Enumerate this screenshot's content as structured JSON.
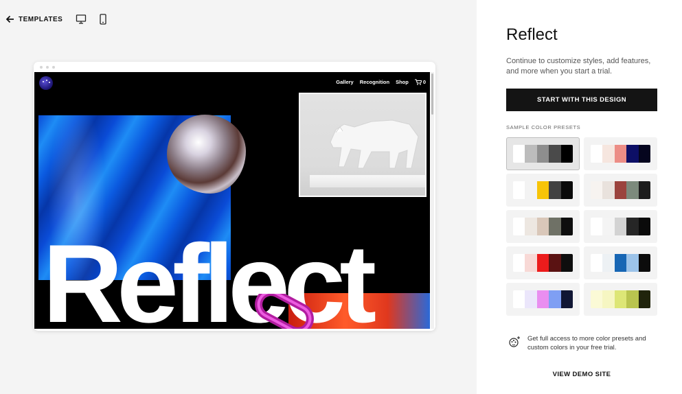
{
  "topbar": {
    "back_label": "TEMPLATES",
    "back_icon": "arrow-left-icon",
    "desktop_icon": "desktop-icon",
    "mobile_icon": "mobile-icon"
  },
  "preview": {
    "nav": [
      "Gallery",
      "Recognition",
      "Shop"
    ],
    "cart_count": "0",
    "hero_word": "Reflect"
  },
  "panel": {
    "title": "Reflect",
    "description": "Continue to customize styles, add features, and more when you start a trial.",
    "start_button": "START WITH THIS DESIGN",
    "presets_label": "SAMPLE COLOR PRESETS",
    "upsell": "Get full access to more color presets and custom colors in your free trial.",
    "demo_link": "VIEW DEMO SITE"
  },
  "presets": [
    [
      "#ffffff",
      "#bcbcbc",
      "#8e8e8e",
      "#4a4a4a",
      "#000000"
    ],
    [
      "#ffffff",
      "#f6e6df",
      "#ec8d86",
      "#0d0f66",
      "#05051e"
    ],
    [
      "#ffffff",
      "#f3f3f3",
      "#f7c408",
      "#424242",
      "#0b0b0b"
    ],
    [
      "#f7f3f0",
      "#e9e2dd",
      "#9b433d",
      "#7c8a7c",
      "#1c1c1c"
    ],
    [
      "#ffffff",
      "#ede7e1",
      "#d9c7b9",
      "#6f7166",
      "#0e0e0e"
    ],
    [
      "#ffffff",
      "#f4f4f4",
      "#d3d3d3",
      "#262626",
      "#0b0b0b"
    ],
    [
      "#ffffff",
      "#f8d9d6",
      "#ec1c1c",
      "#5a1212",
      "#0e0e0e"
    ],
    [
      "#ffffff",
      "#edf1f4",
      "#1766b4",
      "#9cc3e9",
      "#0c0c0c"
    ],
    [
      "#ffffff",
      "#ebe6fb",
      "#e98ef0",
      "#7f9ff3",
      "#101634"
    ],
    [
      "#fbfad6",
      "#f6f6c2",
      "#dde676",
      "#b9c44f",
      "#20240c"
    ]
  ]
}
